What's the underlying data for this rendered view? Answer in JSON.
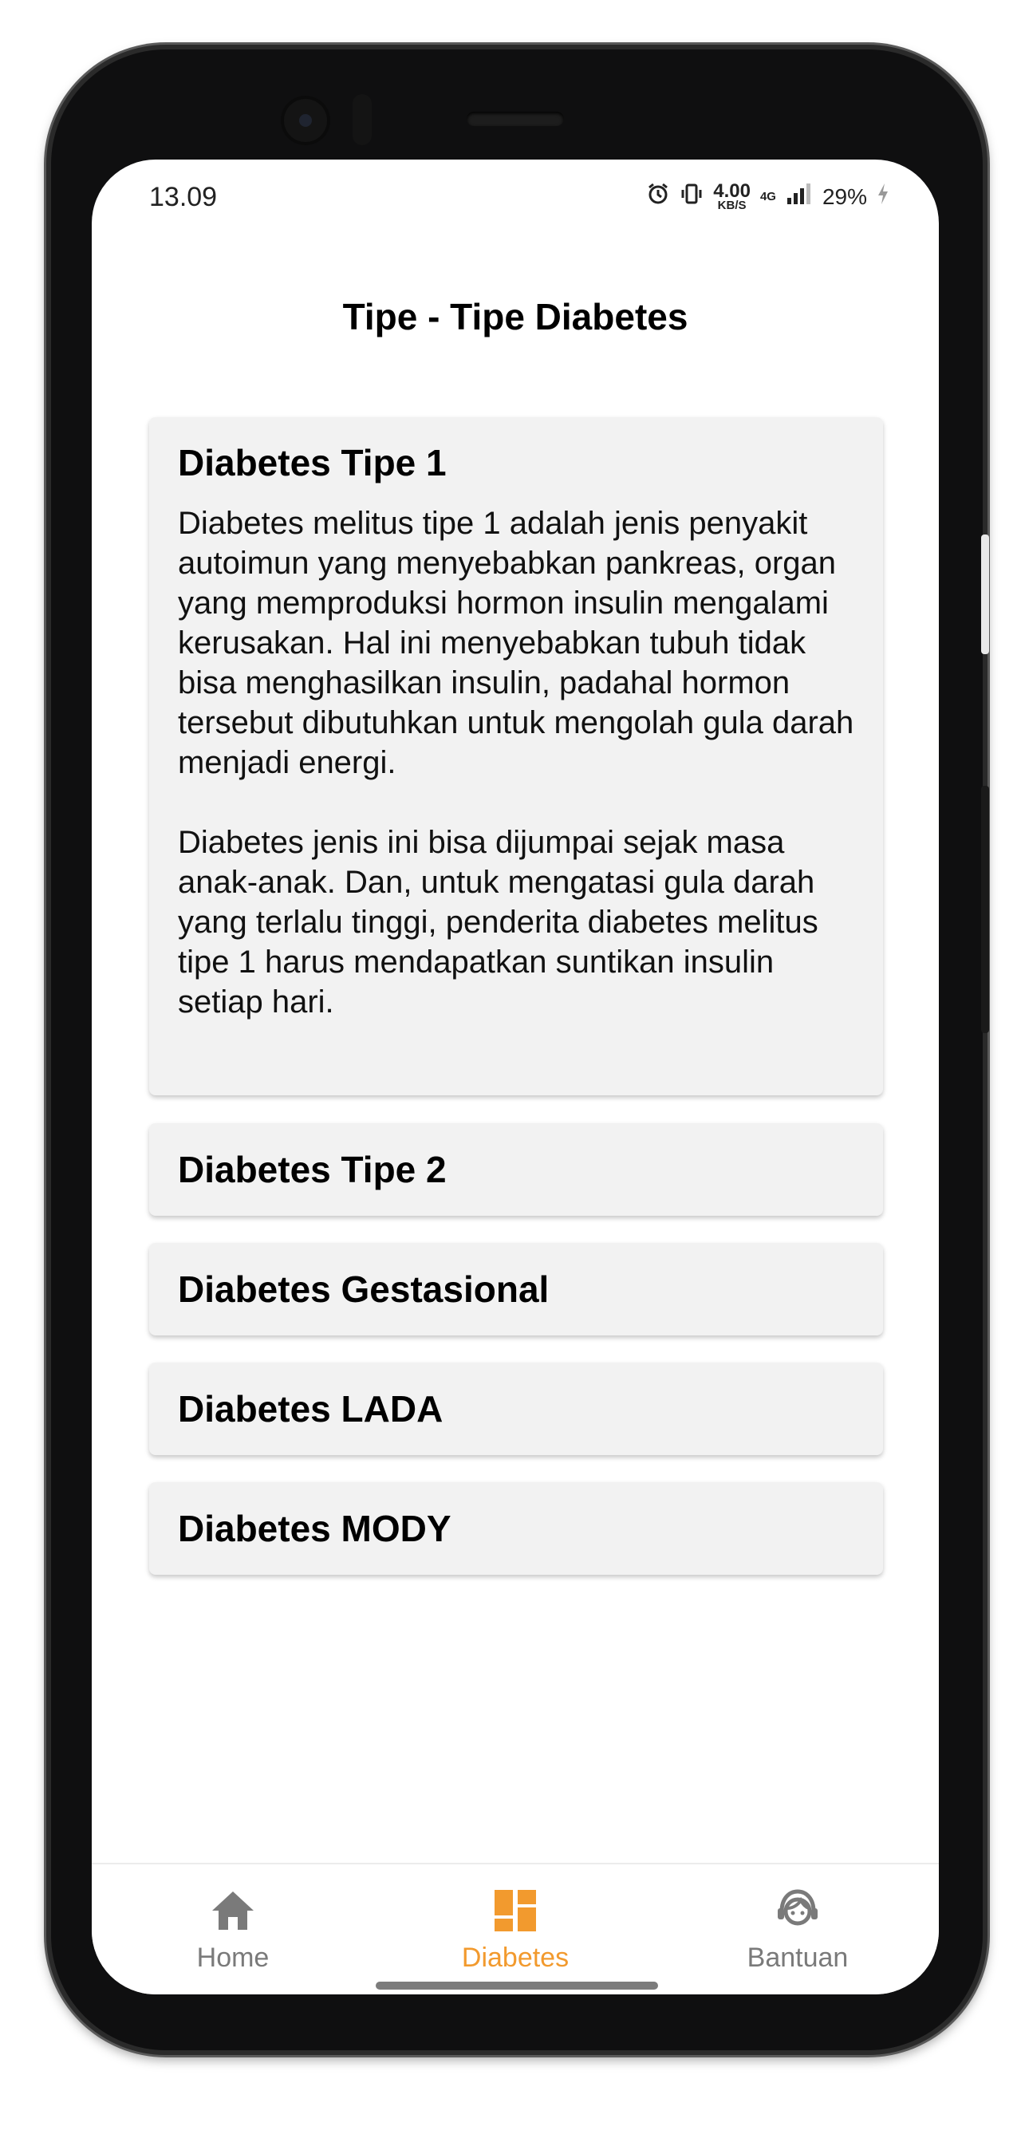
{
  "status_bar": {
    "time": "13.09",
    "net_speed_value": "4.00",
    "net_speed_unit": "KB/S",
    "net_type": "4G",
    "battery": "29%"
  },
  "page": {
    "title": "Tipe - Tipe Diabetes"
  },
  "cards": [
    {
      "title": "Diabetes Tipe 1",
      "expanded": true,
      "paragraphs": [
        "Diabetes melitus tipe 1 adalah jenis penyakit autoimun yang menyebabkan pankreas, organ yang memproduksi hormon insulin mengalami kerusakan. Hal ini menyebabkan tubuh tidak bisa menghasilkan insulin, padahal hormon tersebut dibutuhkan untuk mengolah gula darah menjadi energi.",
        "Diabetes jenis ini bisa dijumpai sejak masa anak-anak. Dan, untuk mengatasi gula darah yang terlalu tinggi, penderita diabetes melitus tipe 1 harus mendapatkan suntikan insulin setiap hari."
      ]
    },
    {
      "title": "Diabetes Tipe 2",
      "expanded": false
    },
    {
      "title": "Diabetes Gestasional",
      "expanded": false
    },
    {
      "title": "Diabetes LADA",
      "expanded": false
    },
    {
      "title": "Diabetes MODY",
      "expanded": false
    }
  ],
  "bottom_nav": {
    "items": [
      {
        "label": "Home",
        "icon": "home-icon",
        "active": false
      },
      {
        "label": "Diabetes",
        "icon": "dashboard-icon",
        "active": true
      },
      {
        "label": "Bantuan",
        "icon": "support-agent-icon",
        "active": false
      }
    ],
    "active_color": "#f29a2e",
    "inactive_color": "#7a7a7a"
  },
  "colors": {
    "card_background": "#f2f2f2",
    "background": "#ffffff"
  }
}
